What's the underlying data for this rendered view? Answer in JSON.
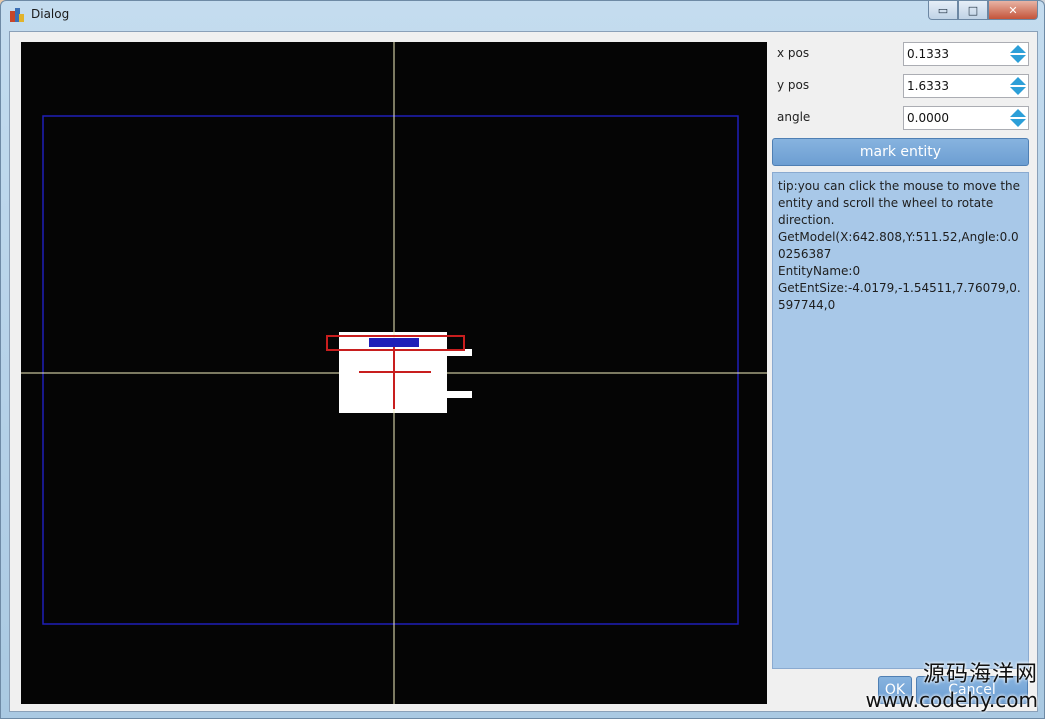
{
  "window": {
    "title": "Dialog",
    "minimize_glyph": "▭",
    "maximize_glyph": "□",
    "close_glyph": "✕"
  },
  "controls": {
    "x_pos": {
      "label": "x pos",
      "value": "0.1333"
    },
    "y_pos": {
      "label": "y pos",
      "value": "1.6333"
    },
    "angle": {
      "label": "angle",
      "value": "0.0000"
    }
  },
  "mark_button_label": "mark entity",
  "info_lines": [
    "tip:you can click the mouse to move the entity and scroll the wheel to rotate direction.",
    "GetModel(X:642.808,Y:511.52,Angle:0.00256387",
    "EntityName:0",
    "GetEntSize:-4.0179,-1.54511,7.76079,0.597744,0"
  ],
  "bottom_buttons": {
    "ok_label": "OK",
    "cancel_label": "Cancel"
  },
  "watermark": {
    "text_cn": "源码海洋网",
    "url": "www.codehy.com"
  },
  "colors": {
    "accent_button": "#6d9ed2",
    "info_bg": "#a8c8e8",
    "spin_arrow": "#2c9fd8",
    "viewport_bg": "#050505",
    "roi_border": "#1f1fb8",
    "crosshair": "#f4f0c0",
    "mark_box": "#c81e1e"
  },
  "icons": {
    "app": "app-icon",
    "spin_up": "arrow-up-icon",
    "spin_down": "arrow-down-icon"
  }
}
